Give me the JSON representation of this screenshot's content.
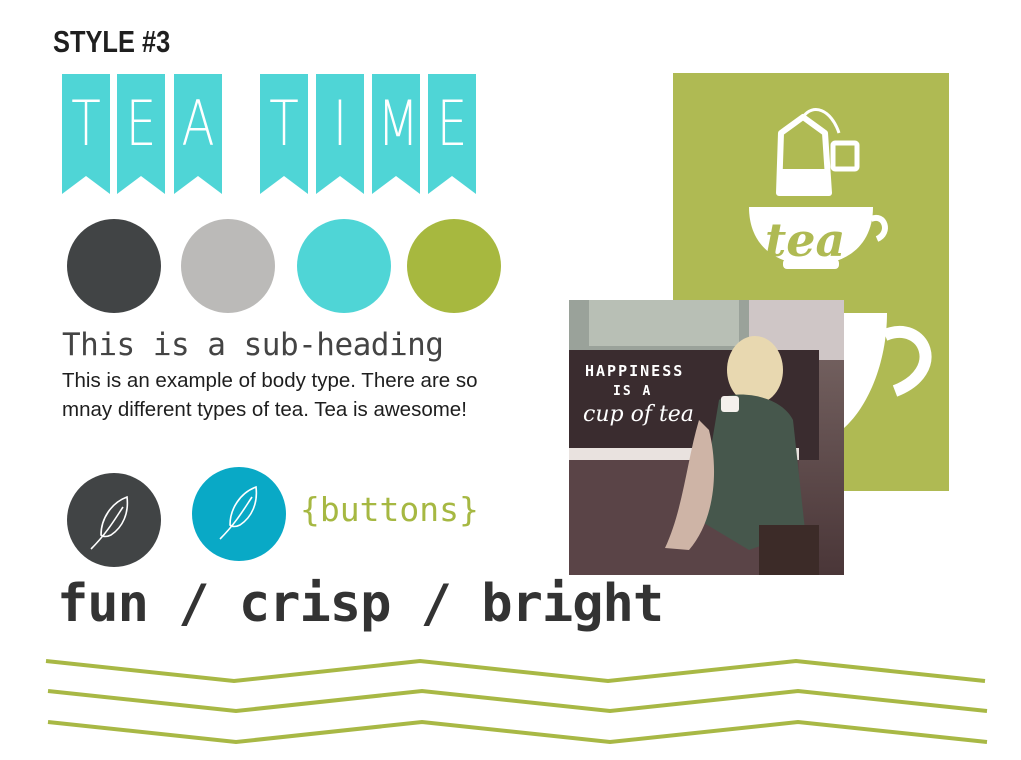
{
  "header": {
    "style_label": "STYLE #3"
  },
  "banner": {
    "word1": [
      "T",
      "E",
      "A"
    ],
    "word2": [
      "T",
      "I",
      "M",
      "E"
    ],
    "color": "#4fd5d6"
  },
  "palette": {
    "swatches": [
      "#414445",
      "#bbbab8",
      "#4fd5d6",
      "#a7b83f"
    ]
  },
  "typography": {
    "subheading": "This is a sub-heading",
    "body": "This is an example of body type. There are so mnay different types of tea. Tea is awesome!"
  },
  "buttons": {
    "label": "{buttons}",
    "items": [
      {
        "color": "#414445",
        "icon": "feather-icon"
      },
      {
        "color": "#09a9c6",
        "icon": "feather-icon"
      }
    ]
  },
  "tagline": "fun / crisp / bright",
  "poster": {
    "bg": "#afba53",
    "cup_word": "tea"
  },
  "photo": {
    "line1": "HAPPINESS",
    "line2": "IS A",
    "line3": "cup of tea"
  },
  "colors": {
    "zigzag": "#a8b845"
  }
}
